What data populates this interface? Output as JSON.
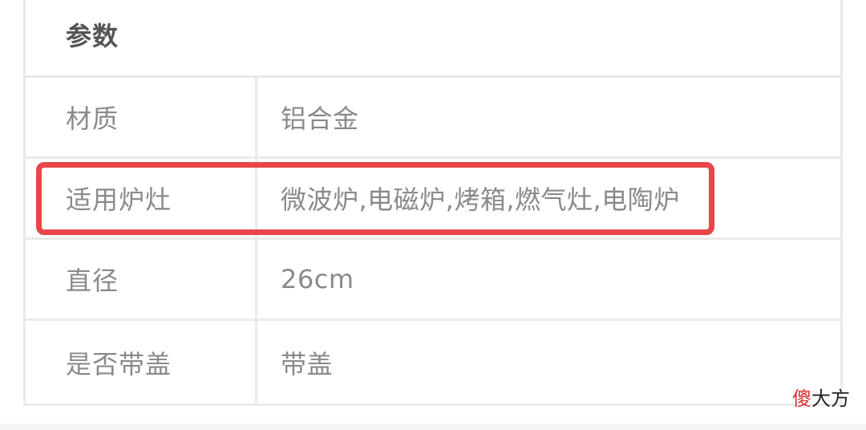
{
  "spec_table": {
    "title": "参数",
    "rows": [
      {
        "key": "材质",
        "value": "铝合金"
      },
      {
        "key": "适用炉灶",
        "value": "微波炉,电磁炉,烤箱,燃气灶,电陶炉"
      },
      {
        "key": "直径",
        "value": "26cm"
      },
      {
        "key": "是否带盖",
        "value": "带盖"
      }
    ]
  },
  "highlight": {
    "color": "#e8464a",
    "row_key": "适用炉灶"
  },
  "watermark": {
    "accent": "傻",
    "rest": "大方",
    "accent_color": "#d9302f"
  }
}
